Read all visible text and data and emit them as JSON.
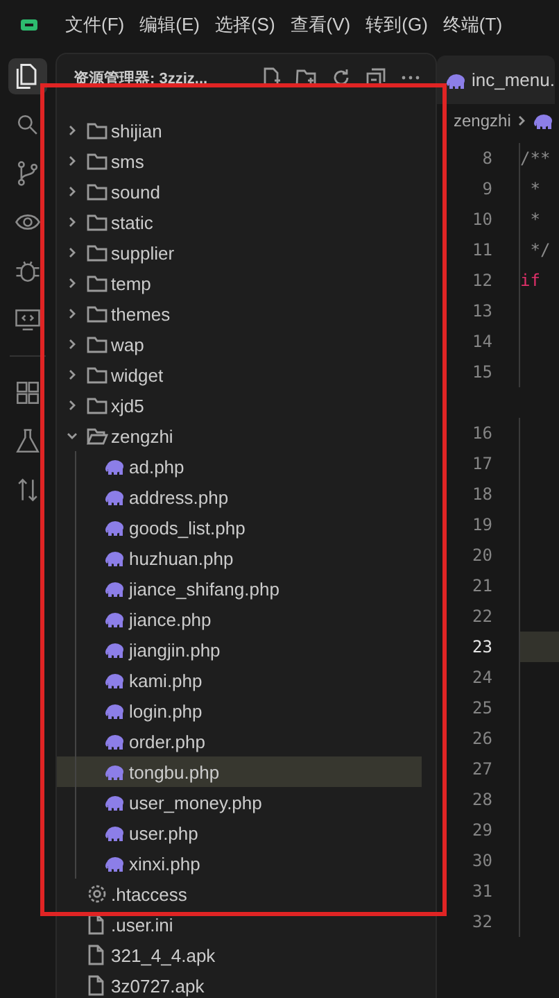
{
  "menu": [
    "文件(F)",
    "编辑(E)",
    "选择(S)",
    "查看(V)",
    "转到(G)",
    "终端(T)"
  ],
  "activity_bar": [
    {
      "kind": "files",
      "selected": true
    },
    {
      "kind": "search",
      "selected": false
    },
    {
      "kind": "source-control",
      "selected": false
    },
    {
      "kind": "eye",
      "selected": false
    },
    {
      "kind": "bug",
      "selected": false
    },
    {
      "kind": "remote",
      "selected": false
    },
    {
      "kind": "divider"
    },
    {
      "kind": "extensions",
      "selected": false
    },
    {
      "kind": "flask",
      "selected": false
    },
    {
      "kind": "sort",
      "selected": false
    }
  ],
  "explorer": {
    "title": "资源管理器: 3zziz...",
    "tree": [
      {
        "name": "shijian",
        "kind": "folder",
        "expanded": false,
        "selected": false
      },
      {
        "name": "sms",
        "kind": "folder",
        "expanded": false,
        "selected": false
      },
      {
        "name": "sound",
        "kind": "folder",
        "expanded": false,
        "selected": false
      },
      {
        "name": "static",
        "kind": "folder",
        "expanded": false,
        "selected": false
      },
      {
        "name": "supplier",
        "kind": "folder",
        "expanded": false,
        "selected": false
      },
      {
        "name": "temp",
        "kind": "folder",
        "expanded": false,
        "selected": false
      },
      {
        "name": "themes",
        "kind": "folder",
        "expanded": false,
        "selected": false
      },
      {
        "name": "wap",
        "kind": "folder",
        "expanded": false,
        "selected": false
      },
      {
        "name": "widget",
        "kind": "folder",
        "expanded": false,
        "selected": false
      },
      {
        "name": "xjd5",
        "kind": "folder",
        "expanded": false,
        "selected": false
      },
      {
        "name": "zengzhi",
        "kind": "folder",
        "expanded": true,
        "selected": false,
        "children": [
          {
            "name": "ad.php",
            "kind": "php",
            "selected": false
          },
          {
            "name": "address.php",
            "kind": "php",
            "selected": false
          },
          {
            "name": "goods_list.php",
            "kind": "php",
            "selected": false
          },
          {
            "name": "huzhuan.php",
            "kind": "php",
            "selected": false
          },
          {
            "name": "jiance_shifang.php",
            "kind": "php",
            "selected": false
          },
          {
            "name": "jiance.php",
            "kind": "php",
            "selected": false
          },
          {
            "name": "jiangjin.php",
            "kind": "php",
            "selected": false
          },
          {
            "name": "kami.php",
            "kind": "php",
            "selected": false
          },
          {
            "name": "login.php",
            "kind": "php",
            "selected": false
          },
          {
            "name": "order.php",
            "kind": "php",
            "selected": false
          },
          {
            "name": "tongbu.php",
            "kind": "php",
            "selected": true
          },
          {
            "name": "user_money.php",
            "kind": "php",
            "selected": false
          },
          {
            "name": "user.php",
            "kind": "php",
            "selected": false
          },
          {
            "name": "xinxi.php",
            "kind": "php",
            "selected": false
          }
        ]
      },
      {
        "name": ".htaccess",
        "kind": "config",
        "selected": false
      },
      {
        "name": ".user.ini",
        "kind": "file",
        "selected": false
      },
      {
        "name": "321_4_4.apk",
        "kind": "file",
        "selected": false
      },
      {
        "name": "3z0727.apk",
        "kind": "file",
        "selected": false
      }
    ]
  },
  "editor": {
    "tab": {
      "label": "inc_menu.",
      "kind": "php"
    },
    "breadcrumb": "zengzhi",
    "lines": [
      {
        "number": "8",
        "current": false,
        "code": [
          {
            "text": "/**",
            "kind": "comment"
          }
        ]
      },
      {
        "number": "9",
        "current": false,
        "code": [
          {
            "text": " *",
            "kind": "comment"
          }
        ]
      },
      {
        "number": "10",
        "current": false,
        "code": [
          {
            "text": " *",
            "kind": "comment"
          }
        ]
      },
      {
        "number": "11",
        "current": false,
        "code": [
          {
            "text": " */",
            "kind": "comment"
          }
        ]
      },
      {
        "number": "12",
        "current": false,
        "code": [
          {
            "text": "if",
            "kind": "keyword"
          }
        ]
      },
      {
        "number": "13",
        "current": false
      },
      {
        "number": "14",
        "current": false
      },
      {
        "number": "15",
        "current": false,
        "wrapped": true
      },
      {
        "number": "16",
        "current": false
      },
      {
        "number": "17",
        "current": false
      },
      {
        "number": "18",
        "current": false
      },
      {
        "number": "19",
        "current": false
      },
      {
        "number": "20",
        "current": false
      },
      {
        "number": "21",
        "current": false
      },
      {
        "number": "22",
        "current": false
      },
      {
        "number": "23",
        "current": true
      },
      {
        "number": "24",
        "current": false
      },
      {
        "number": "25",
        "current": false
      },
      {
        "number": "26",
        "current": false
      },
      {
        "number": "27",
        "current": false
      },
      {
        "number": "28",
        "current": false
      },
      {
        "number": "29",
        "current": false
      },
      {
        "number": "30",
        "current": false
      },
      {
        "number": "31",
        "current": false
      },
      {
        "number": "32",
        "current": false
      }
    ]
  }
}
